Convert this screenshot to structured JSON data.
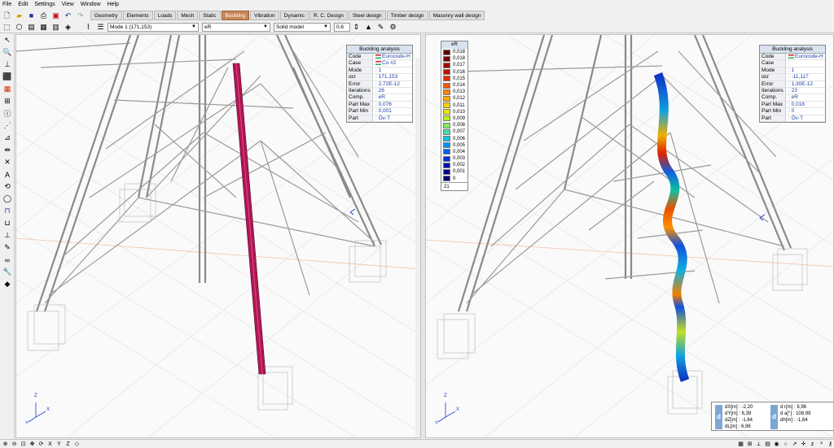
{
  "menu": [
    "File",
    "Edit",
    "Settings",
    "View",
    "Window",
    "Help"
  ],
  "tabs": [
    {
      "label": "Geometry",
      "active": false
    },
    {
      "label": "Elements",
      "active": false
    },
    {
      "label": "Loads",
      "active": false
    },
    {
      "label": "Mesh",
      "active": false
    },
    {
      "label": "Static",
      "active": false
    },
    {
      "label": "Buckling",
      "active": true
    },
    {
      "label": "Vibration",
      "active": false
    },
    {
      "label": "Dynamic",
      "active": false
    },
    {
      "label": "R. C. Design",
      "active": false
    },
    {
      "label": "Steel design",
      "active": false
    },
    {
      "label": "Timber design",
      "active": false
    },
    {
      "label": "Masonry wall design",
      "active": false
    }
  ],
  "toolbar2": {
    "mode_select": "Mode 1 (171,153)",
    "component_select": "eR",
    "view_select": "Solid model",
    "scale_value": "0,6"
  },
  "left_panel": {
    "title": "Buckling analysis",
    "rows": [
      {
        "k": "Code",
        "v": "Eurocode-H",
        "flag": true
      },
      {
        "k": "Case",
        "v": "Co #2"
      },
      {
        "k": "Mode",
        "v": ": 1"
      },
      {
        "k": "αcr",
        "v": ": 171,153"
      },
      {
        "k": "Error",
        "v": ": 2,72E-12"
      },
      {
        "k": "Iterations",
        "v": ": 26"
      },
      {
        "k": "Comp.",
        "v": ": eR"
      },
      {
        "k": "Part Max",
        "v": ": 0,076"
      },
      {
        "k": "Part Min",
        "v": ": 0,001"
      },
      {
        "k": "Part",
        "v": ": Öv-T"
      }
    ]
  },
  "right_panel": {
    "title": "Buckling analysis",
    "rows": [
      {
        "k": "Code",
        "v": "Eurocode-H",
        "flag": true
      },
      {
        "k": "Case",
        "v": ":"
      },
      {
        "k": "Mode",
        "v": ": 1"
      },
      {
        "k": "αcr",
        "v": ": -11,117"
      },
      {
        "k": "Error",
        "v": ": 1,30E-12"
      },
      {
        "k": "Iterations",
        "v": ": 23"
      },
      {
        "k": "Comp.",
        "v": ": eR"
      },
      {
        "k": "Part Max",
        "v": ": 0,018"
      },
      {
        "k": "Part Min",
        "v": ": 0"
      },
      {
        "k": "Part",
        "v": ": Öv-T"
      }
    ]
  },
  "legend": {
    "title": "eR",
    "values": [
      "0,018",
      "0,018",
      "0,017",
      "0,016",
      "0,015",
      "0,014",
      "0,013",
      "0,012",
      "0,011",
      "0,010",
      "0,009",
      "0,008",
      "0,007",
      "0,006",
      "0,005",
      "0,004",
      "0,003",
      "0,002",
      "0,001",
      "0"
    ],
    "colors": [
      "#5a0000",
      "#7a0000",
      "#a00000",
      "#c41000",
      "#e02e00",
      "#f05a00",
      "#f98400",
      "#ffac00",
      "#ffd000",
      "#e8e800",
      "#b8f020",
      "#80f060",
      "#40e0a0",
      "#10c0e0",
      "#0090f8",
      "#0060f0",
      "#0030d8",
      "#0010b0",
      "#00008c",
      "#000070"
    ],
    "count": "21"
  },
  "displacements": {
    "left": [
      "dX[m] : -2,20",
      "dY[m] : 6,39",
      "dZ[m] : -1,64",
      "dL[m] : 6,96"
    ],
    "right": [
      "d r[m] : 6,96",
      "d a[°] : 108,99",
      "dh[m] : -1,64"
    ]
  },
  "axis_labels": {
    "z": "Z",
    "x": "X",
    "y": "Y"
  },
  "accent": "#c8865a"
}
